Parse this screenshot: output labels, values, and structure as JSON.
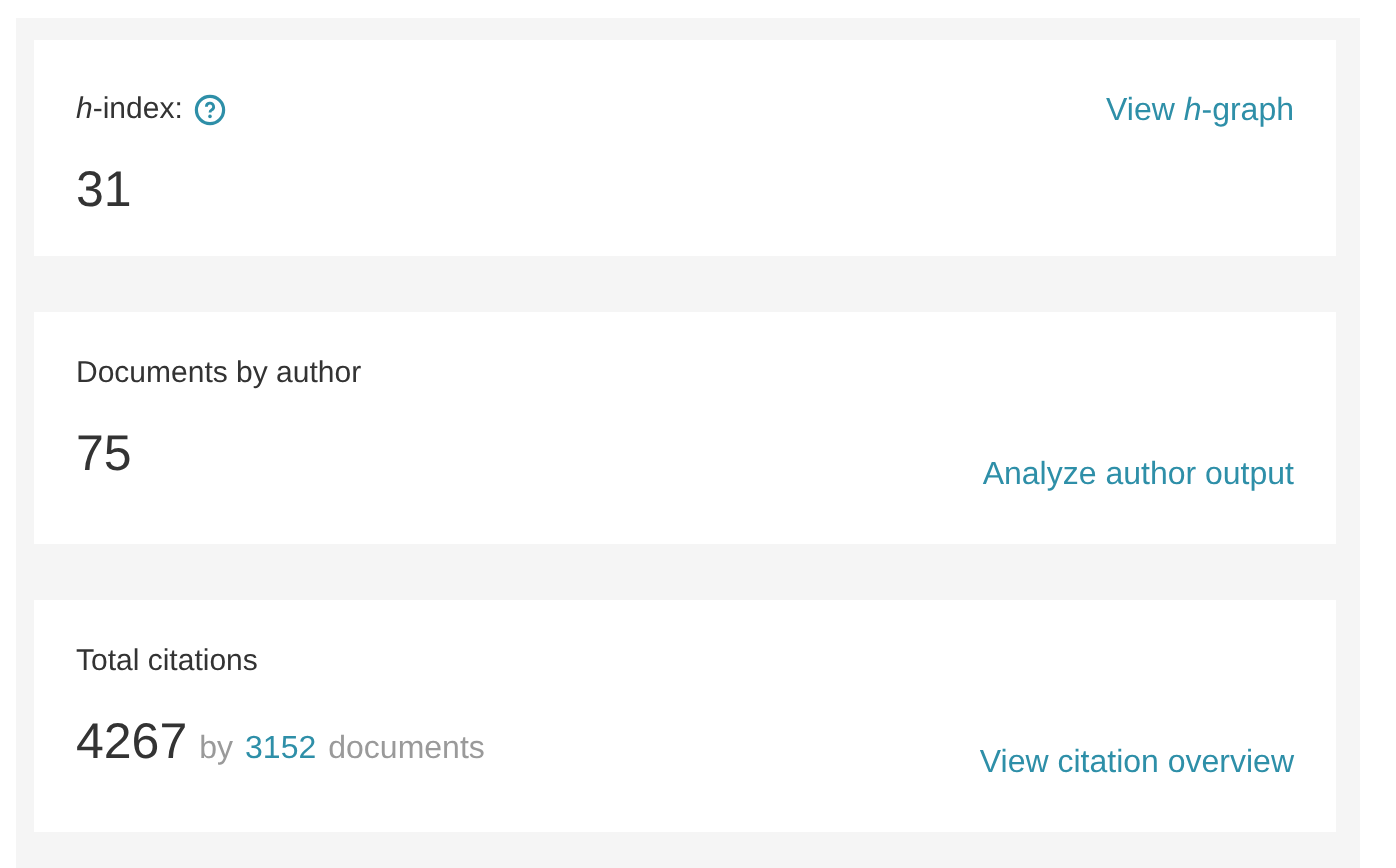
{
  "cards": [
    {
      "label": "*h*-index:",
      "help_icon": true,
      "value": "31",
      "link": "View *h*-graph",
      "kind": "inline"
    },
    {
      "label": "Documents by author",
      "help_icon": false,
      "value": "75",
      "link": "Analyze author output",
      "kind": "stacked"
    },
    {
      "label": "Total citations",
      "help_icon": false,
      "value": "4267",
      "by": "by",
      "documents_count": "3152",
      "documents_label": "documents",
      "link": "View citation overview",
      "kind": "stacked"
    }
  ]
}
